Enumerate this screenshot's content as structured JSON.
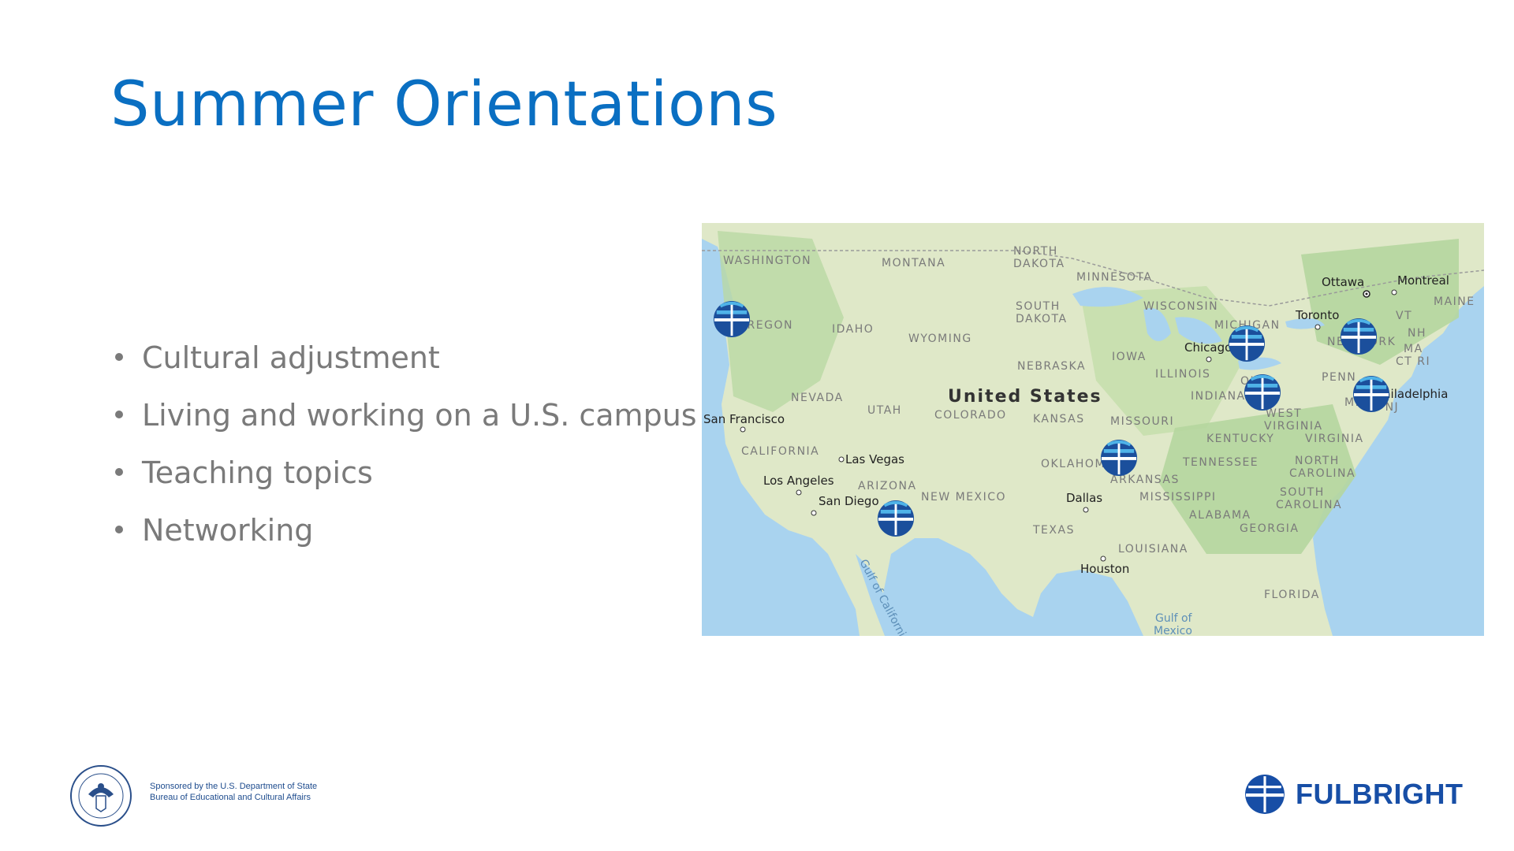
{
  "slide": {
    "title": "Summer Orientations",
    "bullets": [
      "Cultural adjustment",
      "Living and working on a U.S. campus",
      "Teaching topics",
      "Networking"
    ]
  },
  "map": {
    "country_label": "United States",
    "states": [
      "WASHINGTON",
      "MONTANA",
      "NORTH DAKOTA",
      "MINNESOTA",
      "SOUTH DAKOTA",
      "OREGON",
      "IDAHO",
      "WYOMING",
      "WISCONSIN",
      "MICHIGAN",
      "NEBRASKA",
      "IOWA",
      "ILLINOIS",
      "INDIANA",
      "OHIO",
      "NEVADA",
      "UTAH",
      "COLORADO",
      "KANSAS",
      "MISSOURI",
      "WEST VIRGINIA",
      "VIRGINIA",
      "KENTUCKY",
      "CALIFORNIA",
      "OKLAHOMA",
      "ARKANSAS",
      "TENNESSEE",
      "NORTH CAROLINA",
      "ARIZONA",
      "NEW MEXICO",
      "MISSISSIPPI",
      "ALABAMA",
      "SOUTH CAROLINA",
      "GEORGIA",
      "TEXAS",
      "LOUISIANA",
      "FLORIDA",
      "MAINE",
      "VT",
      "NH",
      "MA",
      "CT RI",
      "PENN",
      "NEW YORK",
      "MD",
      "DE NJ"
    ],
    "cities": [
      "Ottawa",
      "Montreal",
      "Toronto",
      "Chicago",
      "Philadelphia",
      "San Francisco",
      "Las Vegas",
      "Los Angeles",
      "San Diego",
      "Dallas",
      "Houston"
    ],
    "water": [
      "Gulf of California",
      "Gulf of Mexico"
    ],
    "markers": 7,
    "marker_icon": "fulbright-globe-icon"
  },
  "footer": {
    "seal_icon": "department-of-state-seal-icon",
    "sponsor_line1": "Sponsored by the U.S. Department of State",
    "sponsor_line2": "Bureau of Educational and Cultural Affairs",
    "brand_icon": "fulbright-globe-icon",
    "brand_name": "FULBRIGHT"
  },
  "colors": {
    "title": "#0a6fc2",
    "bullet_text": "#7a7a7a",
    "brand_blue": "#174ea6",
    "map_water": "#a9d3ef",
    "map_land": "#dfe8c8"
  }
}
